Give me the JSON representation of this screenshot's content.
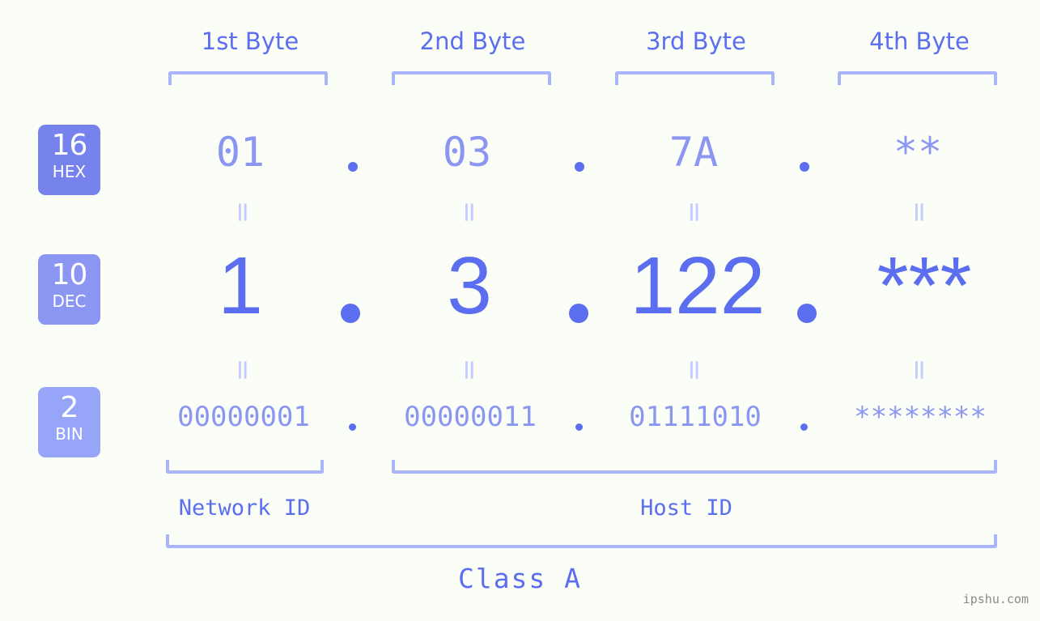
{
  "meta": {
    "background_color": "#fbfdf7",
    "accent_color": "#5b6ef0",
    "accent_light": "#8b96f2",
    "accent_lighter": "#aab4fb",
    "separator_color": "#c3caff",
    "watermark": "ipshu.com"
  },
  "byte_headers": [
    {
      "label": "1st Byte"
    },
    {
      "label": "2nd Byte"
    },
    {
      "label": "3rd Byte"
    },
    {
      "label": "4th Byte"
    }
  ],
  "bases": [
    {
      "id": "hex",
      "number": "16",
      "abbr": "HEX",
      "color": "#7683ed"
    },
    {
      "id": "dec",
      "number": "10",
      "abbr": "DEC",
      "color": "#8b96f2"
    },
    {
      "id": "bin",
      "number": "2",
      "abbr": "BIN",
      "color": "#96a5f7"
    }
  ],
  "rows": {
    "hex": {
      "values": [
        "01",
        "03",
        "7A",
        "**"
      ],
      "separators": [
        ".",
        ".",
        "."
      ]
    },
    "dec": {
      "values": [
        "1",
        "3",
        "122",
        "***"
      ],
      "separators": [
        ".",
        ".",
        "."
      ]
    },
    "bin": {
      "values": [
        "00000001",
        "00000011",
        "01111010",
        "********"
      ],
      "separators": [
        ".",
        ".",
        "."
      ]
    }
  },
  "equals_separators": {
    "glyph": "=",
    "rows": [
      "hex-to-dec",
      "dec-to-bin"
    ],
    "count_per_row": 4
  },
  "id_sections": [
    {
      "key": "network",
      "label": "Network ID"
    },
    {
      "key": "host",
      "label": "Host ID"
    }
  ],
  "class_label": "Class A"
}
